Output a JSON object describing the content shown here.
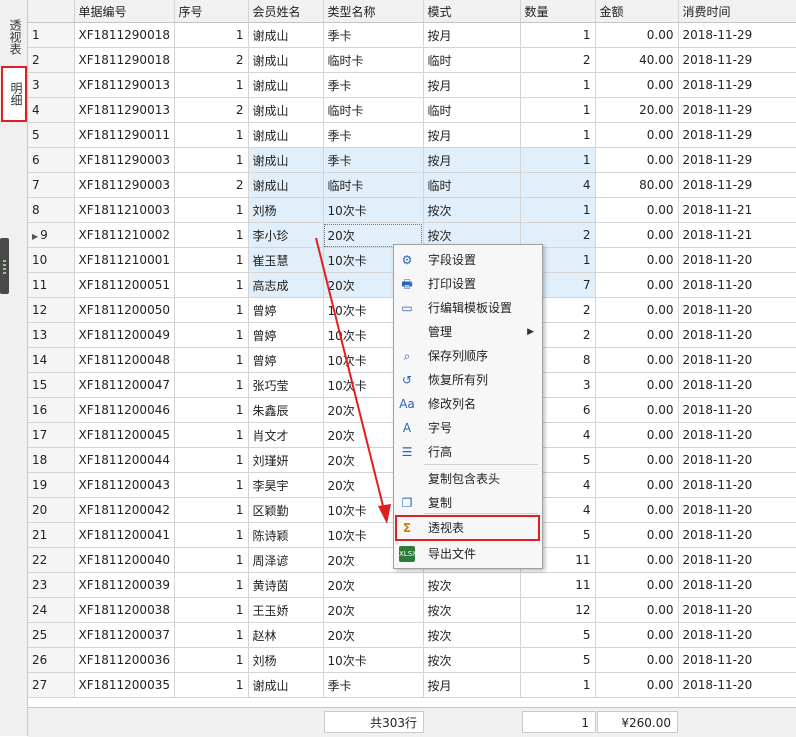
{
  "side_tabs": [
    "透视表",
    "明细"
  ],
  "columns": [
    "单据编号",
    "序号",
    "会员姓名",
    "类型名称",
    "模式",
    "数量",
    "金额",
    "消费时间"
  ],
  "rows": [
    {
      "n": "1",
      "id": "XF1811290018",
      "seq": "1",
      "name": "谢成山",
      "type": "季卡",
      "mode": "按月",
      "qty": "1",
      "amt": "0.00",
      "date": "2018-11-29"
    },
    {
      "n": "2",
      "id": "XF1811290018",
      "seq": "2",
      "name": "谢成山",
      "type": "临时卡",
      "mode": "临时",
      "qty": "2",
      "amt": "40.00",
      "date": "2018-11-29"
    },
    {
      "n": "3",
      "id": "XF1811290013",
      "seq": "1",
      "name": "谢成山",
      "type": "季卡",
      "mode": "按月",
      "qty": "1",
      "amt": "0.00",
      "date": "2018-11-29"
    },
    {
      "n": "4",
      "id": "XF1811290013",
      "seq": "2",
      "name": "谢成山",
      "type": "临时卡",
      "mode": "临时",
      "qty": "1",
      "amt": "20.00",
      "date": "2018-11-29"
    },
    {
      "n": "5",
      "id": "XF1811290011",
      "seq": "1",
      "name": "谢成山",
      "type": "季卡",
      "mode": "按月",
      "qty": "1",
      "amt": "0.00",
      "date": "2018-11-29"
    },
    {
      "n": "6",
      "id": "XF1811290003",
      "seq": "1",
      "name": "谢成山",
      "type": "季卡",
      "mode": "按月",
      "qty": "1",
      "amt": "0.00",
      "date": "2018-11-29"
    },
    {
      "n": "7",
      "id": "XF1811290003",
      "seq": "2",
      "name": "谢成山",
      "type": "临时卡",
      "mode": "临时",
      "qty": "4",
      "amt": "80.00",
      "date": "2018-11-29"
    },
    {
      "n": "8",
      "id": "XF1811210003",
      "seq": "1",
      "name": "刘杨",
      "type": "10次卡",
      "mode": "按次",
      "qty": "1",
      "amt": "0.00",
      "date": "2018-11-21"
    },
    {
      "n": "9",
      "id": "XF1811210002",
      "seq": "1",
      "name": "李小珍",
      "type": "20次",
      "mode": "按次",
      "qty": "2",
      "amt": "0.00",
      "date": "2018-11-21"
    },
    {
      "n": "10",
      "id": "XF1811210001",
      "seq": "1",
      "name": "崔玉慧",
      "type": "10次卡",
      "mode": "",
      "qty": "1",
      "amt": "0.00",
      "date": "2018-11-20"
    },
    {
      "n": "11",
      "id": "XF1811200051",
      "seq": "1",
      "name": "高志成",
      "type": "20次",
      "mode": "",
      "qty": "7",
      "amt": "0.00",
      "date": "2018-11-20"
    },
    {
      "n": "12",
      "id": "XF1811200050",
      "seq": "1",
      "name": "曾婷",
      "type": "10次卡",
      "mode": "",
      "qty": "2",
      "amt": "0.00",
      "date": "2018-11-20"
    },
    {
      "n": "13",
      "id": "XF1811200049",
      "seq": "1",
      "name": "曾婷",
      "type": "10次卡",
      "mode": "",
      "qty": "2",
      "amt": "0.00",
      "date": "2018-11-20"
    },
    {
      "n": "14",
      "id": "XF1811200048",
      "seq": "1",
      "name": "曾婷",
      "type": "10次卡",
      "mode": "",
      "qty": "8",
      "amt": "0.00",
      "date": "2018-11-20"
    },
    {
      "n": "15",
      "id": "XF1811200047",
      "seq": "1",
      "name": "张巧莹",
      "type": "10次卡",
      "mode": "",
      "qty": "3",
      "amt": "0.00",
      "date": "2018-11-20"
    },
    {
      "n": "16",
      "id": "XF1811200046",
      "seq": "1",
      "name": "朱鑫辰",
      "type": "20次",
      "mode": "",
      "qty": "6",
      "amt": "0.00",
      "date": "2018-11-20"
    },
    {
      "n": "17",
      "id": "XF1811200045",
      "seq": "1",
      "name": "肖文才",
      "type": "20次",
      "mode": "",
      "qty": "4",
      "amt": "0.00",
      "date": "2018-11-20"
    },
    {
      "n": "18",
      "id": "XF1811200044",
      "seq": "1",
      "name": "刘瑾妍",
      "type": "20次",
      "mode": "",
      "qty": "5",
      "amt": "0.00",
      "date": "2018-11-20"
    },
    {
      "n": "19",
      "id": "XF1811200043",
      "seq": "1",
      "name": "李昊宇",
      "type": "20次",
      "mode": "",
      "qty": "4",
      "amt": "0.00",
      "date": "2018-11-20"
    },
    {
      "n": "20",
      "id": "XF1811200042",
      "seq": "1",
      "name": "区颖勤",
      "type": "10次卡",
      "mode": "",
      "qty": "4",
      "amt": "0.00",
      "date": "2018-11-20"
    },
    {
      "n": "21",
      "id": "XF1811200041",
      "seq": "1",
      "name": "陈诗颖",
      "type": "10次卡",
      "mode": "",
      "qty": "5",
      "amt": "0.00",
      "date": "2018-11-20"
    },
    {
      "n": "22",
      "id": "XF1811200040",
      "seq": "1",
      "name": "周泽谚",
      "type": "20次",
      "mode": "",
      "qty": "11",
      "amt": "0.00",
      "date": "2018-11-20"
    },
    {
      "n": "23",
      "id": "XF1811200039",
      "seq": "1",
      "name": "黄诗茵",
      "type": "20次",
      "mode": "按次",
      "qty": "11",
      "amt": "0.00",
      "date": "2018-11-20"
    },
    {
      "n": "24",
      "id": "XF1811200038",
      "seq": "1",
      "name": "王玉娇",
      "type": "20次",
      "mode": "按次",
      "qty": "12",
      "amt": "0.00",
      "date": "2018-11-20"
    },
    {
      "n": "25",
      "id": "XF1811200037",
      "seq": "1",
      "name": "赵林",
      "type": "20次",
      "mode": "按次",
      "qty": "5",
      "amt": "0.00",
      "date": "2018-11-20"
    },
    {
      "n": "26",
      "id": "XF1811200036",
      "seq": "1",
      "name": "刘杨",
      "type": "10次卡",
      "mode": "按次",
      "qty": "5",
      "amt": "0.00",
      "date": "2018-11-20"
    },
    {
      "n": "27",
      "id": "XF1811200035",
      "seq": "1",
      "name": "谢成山",
      "type": "季卡",
      "mode": "按月",
      "qty": "1",
      "amt": "0.00",
      "date": "2018-11-20"
    }
  ],
  "footer": {
    "count_text": "共303行",
    "qty_total": "1",
    "amount_total": "¥260.00"
  },
  "context_menu": [
    {
      "label": "字段设置",
      "icon": "field-settings-icon",
      "glyph": "⚙"
    },
    {
      "label": "打印设置",
      "icon": "printer-icon",
      "glyph": "🖶"
    },
    {
      "label": "行编辑模板设置",
      "icon": "window-icon",
      "glyph": "▭"
    },
    {
      "label": "管理",
      "icon": "blank-icon",
      "glyph": "",
      "submenu": true
    },
    {
      "label": "保存列顺序",
      "icon": "save-columns-icon",
      "glyph": "⌕"
    },
    {
      "label": "恢复所有列",
      "icon": "restore-icon",
      "glyph": "↺"
    },
    {
      "label": "修改列名",
      "icon": "rename-icon",
      "glyph": "Aa"
    },
    {
      "label": "字号",
      "icon": "font-size-icon",
      "glyph": "A"
    },
    {
      "label": "行高",
      "icon": "row-height-icon",
      "glyph": "☰"
    },
    {
      "label": "复制包含表头",
      "icon": "blank-icon",
      "glyph": ""
    },
    {
      "label": "复制",
      "icon": "copy-icon",
      "glyph": "❐"
    },
    {
      "label": "透视表",
      "icon": "sigma-icon",
      "glyph": "Σ"
    },
    {
      "label": "导出文件",
      "icon": "xlsx-icon",
      "glyph": "XLSX"
    }
  ],
  "accent_color": "#e02020",
  "selection_color": "#e1effa"
}
